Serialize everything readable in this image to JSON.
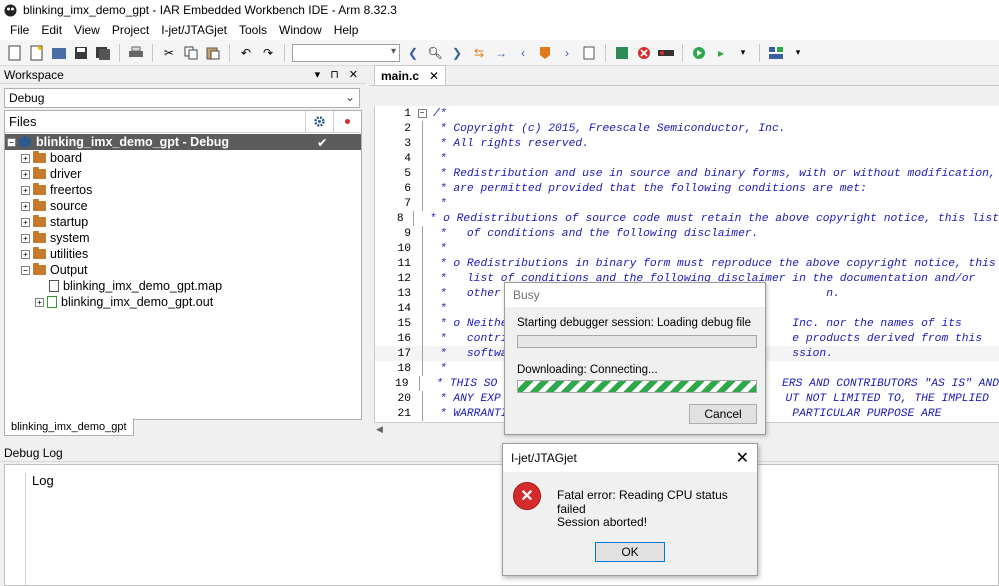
{
  "titlebar": {
    "title": "blinking_imx_demo_gpt - IAR Embedded Workbench IDE - Arm 8.32.3"
  },
  "menu": [
    "File",
    "Edit",
    "View",
    "Project",
    "I-jet/JTAGjet",
    "Tools",
    "Window",
    "Help"
  ],
  "workspace": {
    "title": "Workspace",
    "controls": [
      "▾",
      "⊓",
      "✕"
    ],
    "config": "Debug",
    "files_header": "Files",
    "tree": [
      {
        "label": "blinking_imx_demo_gpt - Debug",
        "check": "✔"
      },
      {
        "label": "board"
      },
      {
        "label": "driver"
      },
      {
        "label": "freertos"
      },
      {
        "label": "source"
      },
      {
        "label": "startup"
      },
      {
        "label": "system"
      },
      {
        "label": "utilities"
      },
      {
        "label": "Output"
      },
      {
        "label": "blinking_imx_demo_gpt.map"
      },
      {
        "label": "blinking_imx_demo_gpt.out"
      }
    ],
    "tab": "blinking_imx_demo_gpt"
  },
  "editor": {
    "tab": "main.c",
    "lines": [
      {
        "n": "1",
        "t": "/*"
      },
      {
        "n": "2",
        "t": " * Copyright (c) 2015, Freescale Semiconductor, Inc."
      },
      {
        "n": "3",
        "t": " * All rights reserved."
      },
      {
        "n": "4",
        "t": " *"
      },
      {
        "n": "5",
        "t": " * Redistribution and use in source and binary forms, with or without modification,"
      },
      {
        "n": "6",
        "t": " * are permitted provided that the following conditions are met:"
      },
      {
        "n": "7",
        "t": " *"
      },
      {
        "n": "8",
        "t": " * o Redistributions of source code must retain the above copyright notice, this list"
      },
      {
        "n": "9",
        "t": " *   of conditions and the following disclaimer."
      },
      {
        "n": "10",
        "t": " *"
      },
      {
        "n": "11",
        "t": " * o Redistributions in binary form must reproduce the above copyright notice, this"
      },
      {
        "n": "12",
        "t": " *   list of conditions and the following disclaimer in the documentation and/or"
      },
      {
        "n": "13",
        "t": " *   other                                                n."
      },
      {
        "n": "14",
        "t": " *"
      },
      {
        "n": "15",
        "t": " * o Neithe                                          Inc. nor the names of its"
      },
      {
        "n": "16",
        "t": " *   contri                                          e products derived from this"
      },
      {
        "n": "17",
        "t": " *   softwa                                          ssion."
      },
      {
        "n": "18",
        "t": " *"
      },
      {
        "n": "19",
        "t": " * THIS SO                                          ERS AND CONTRIBUTORS \"AS IS\" AND"
      },
      {
        "n": "20",
        "t": " * ANY EXP                                          UT NOT LIMITED TO, THE IMPLIED"
      },
      {
        "n": "21",
        "t": " * WARRANTI                                          PARTICULAR PURPOSE ARE"
      }
    ]
  },
  "debuglog": {
    "title": "Debug Log",
    "column": "Log"
  },
  "busy": {
    "title": "Busy",
    "status1": "Starting debugger session: Loading debug file",
    "status2": "Downloading: Connecting...",
    "cancel": "Cancel"
  },
  "error": {
    "title": "I-jet/JTAGjet",
    "close": "✕",
    "message1": "Fatal error: Reading CPU status failed",
    "message2": "Session aborted!",
    "ok": "OK"
  }
}
